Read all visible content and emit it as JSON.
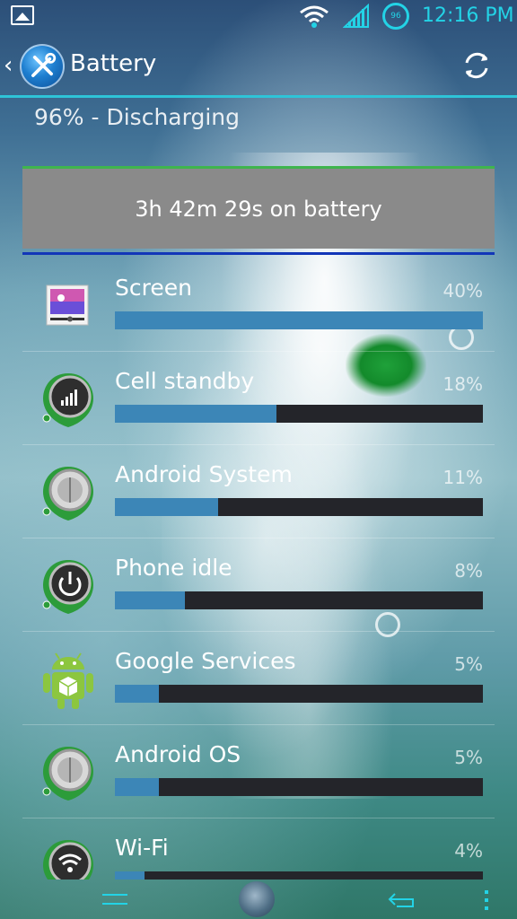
{
  "status_bar": {
    "battery_level": "96",
    "time": "12:16 PM"
  },
  "action_bar": {
    "title": "Battery"
  },
  "summary": "96% - Discharging",
  "graph": {
    "text": "3h 42m 29s on battery"
  },
  "usage_items": [
    {
      "label": "Screen",
      "percent": "40%",
      "fill": 1.0,
      "icon": "screen-icon"
    },
    {
      "label": "Cell standby",
      "percent": "18%",
      "fill": 0.44,
      "icon": "cell-signal-icon"
    },
    {
      "label": "Android System",
      "percent": "11%",
      "fill": 0.28,
      "icon": "android-system-icon"
    },
    {
      "label": "Phone idle",
      "percent": "8%",
      "fill": 0.19,
      "icon": "power-icon"
    },
    {
      "label": "Google Services",
      "percent": "5%",
      "fill": 0.12,
      "icon": "android-robot-icon"
    },
    {
      "label": "Android OS",
      "percent": "5%",
      "fill": 0.12,
      "icon": "android-os-icon"
    },
    {
      "label": "Wi-Fi",
      "percent": "4%",
      "fill": 0.08,
      "icon": "wifi-icon"
    }
  ],
  "colors": {
    "accent": "#23d3e6",
    "bar_fill": "#3c86b7",
    "bar_track": "#24252a",
    "graph_bg": "#8a8a8a",
    "graph_line": "#3fb54d",
    "graph_underline": "#1236b8"
  }
}
